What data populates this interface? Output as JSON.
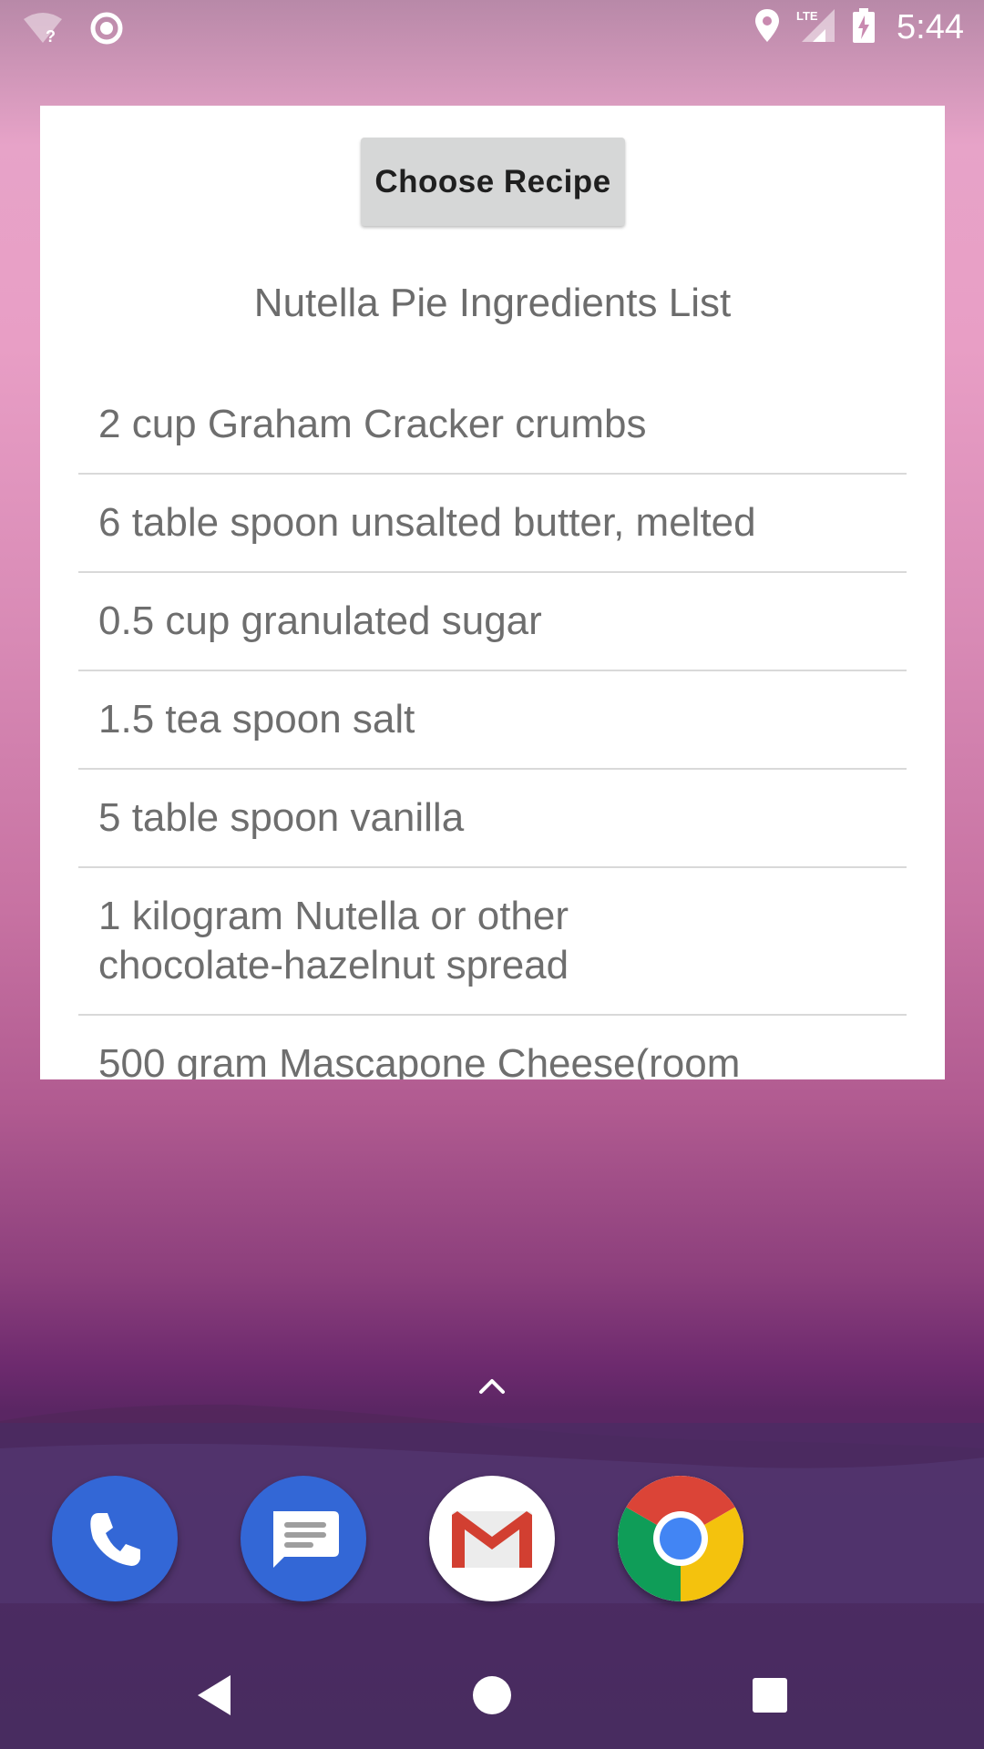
{
  "status_bar": {
    "time": "5:44",
    "network": "LTE",
    "icons": [
      "wifi-unknown-icon",
      "sync-icon",
      "location-icon",
      "lte-signal-icon",
      "battery-charging-icon"
    ]
  },
  "widget": {
    "button_label": "Choose Recipe",
    "title": "Nutella Pie Ingredients List",
    "ingredients": [
      "2 cup Graham Cracker crumbs",
      "6 table spoon unsalted butter, melted",
      "0.5 cup granulated sugar",
      "1.5 tea spoon salt",
      "5 table spoon vanilla",
      "1 kilogram Nutella or other chocolate-hazelnut spread",
      "500 gram Mascapone Cheese(room"
    ]
  },
  "dock": {
    "apps": [
      "Phone",
      "Messages",
      "Gmail",
      "Chrome"
    ],
    "icons": [
      "phone-icon",
      "messages-icon",
      "gmail-icon",
      "chrome-icon"
    ]
  },
  "nav": {
    "icons": [
      "back-icon",
      "home-icon",
      "recents-icon"
    ]
  },
  "colors": {
    "button_bg": "#d6d7d7",
    "card_bg": "#ffffff",
    "text_gray": "#6e6e6e",
    "divider": "#d9d9d9"
  }
}
